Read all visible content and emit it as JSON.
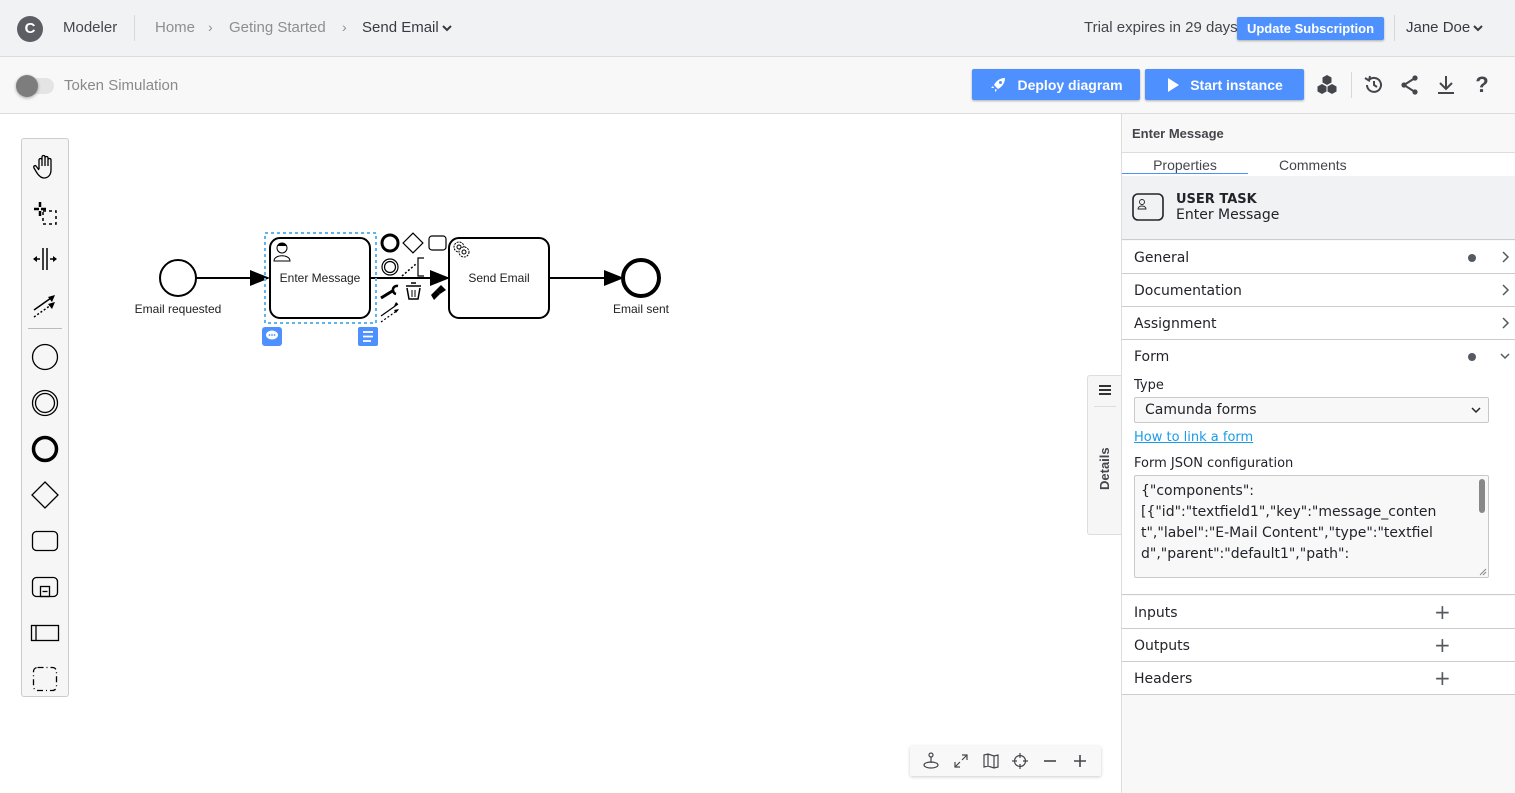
{
  "header": {
    "logo_letter": "C",
    "app_name": "Modeler",
    "breadcrumb": [
      {
        "label": "Home"
      },
      {
        "label": "Geting Started"
      },
      {
        "label": "Send Email"
      }
    ],
    "breadcrumb_separator": "›",
    "trial_text": "Trial expires in 29 days",
    "update_button": "Update Subscription",
    "user_name": "Jane Doe"
  },
  "toolbar": {
    "token_simulation_label": "Token Simulation",
    "token_simulation_on": false,
    "deploy_button": "Deploy diagram",
    "start_button": "Start instance",
    "icons": [
      "deployments-icon",
      "history-icon",
      "share-icon",
      "download-icon",
      "help-icon"
    ],
    "help_glyph": "?"
  },
  "palette": {
    "tools": [
      "hand-tool",
      "lasso-tool",
      "space-tool",
      "connect-tool"
    ],
    "shapes": [
      "start-event",
      "intermediate-event",
      "end-event",
      "gateway",
      "task",
      "subprocess",
      "pool",
      "group"
    ]
  },
  "diagram": {
    "elements": [
      {
        "type": "start-event",
        "label": "Email requested"
      },
      {
        "type": "user-task",
        "label": "Enter Message",
        "selected": true
      },
      {
        "type": "service-task",
        "label": "Send Email"
      },
      {
        "type": "end-event",
        "label": "Email sent"
      }
    ]
  },
  "details_tab": {
    "label": "Details"
  },
  "zoom_controls": [
    "reset-position-icon",
    "fit-viewport-icon",
    "minimap-icon",
    "center-icon",
    "zoom-out-icon",
    "zoom-in-icon"
  ],
  "properties": {
    "title": "Enter Message",
    "tabs": [
      {
        "label": "Properties",
        "active": true
      },
      {
        "label": "Comments",
        "active": false
      }
    ],
    "element_type": "USER TASK",
    "element_name": "Enter Message",
    "groups": [
      {
        "label": "General",
        "has_data": true,
        "expanded": false
      },
      {
        "label": "Documentation",
        "has_data": false,
        "expanded": false
      },
      {
        "label": "Assignment",
        "has_data": false,
        "expanded": false
      },
      {
        "label": "Form",
        "has_data": true,
        "expanded": true
      }
    ],
    "form": {
      "type_label": "Type",
      "type_value": "Camunda forms",
      "link_text": "How to link a form",
      "json_label": "Form JSON configuration",
      "json_value": "{\"components\":\n[{\"id\":\"textfield1\",\"key\":\"message_content\",\"label\":\"E-Mail Content\",\"type\":\"textfield\",\"parent\":\"default1\",\"path\":"
    },
    "list_groups": [
      {
        "label": "Inputs"
      },
      {
        "label": "Outputs"
      },
      {
        "label": "Headers"
      }
    ]
  },
  "colors": {
    "accent": "#4d90fe",
    "link": "#1a9bea",
    "selection": "#5fb4ee"
  }
}
